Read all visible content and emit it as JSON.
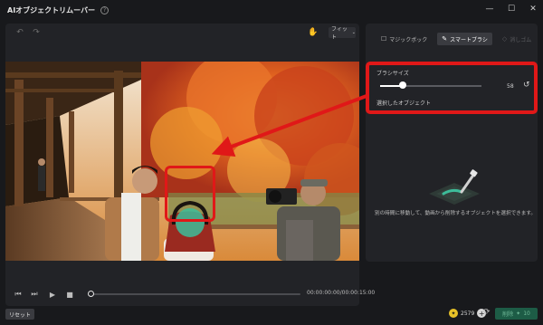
{
  "window": {
    "title": "AIオブジェクトリムーバー",
    "help_icon": "?",
    "controls": {
      "minimize": "—",
      "maximize": "☐",
      "close": "✕"
    }
  },
  "toolbar": {
    "undo_icon": "↶",
    "redo_icon": "↷",
    "hand_icon": "✋",
    "fit_label": "フィット",
    "fit_chevron": "⌄"
  },
  "playback": {
    "prev_icon": "⏮",
    "step_icon": "⏭",
    "play_icon": "▶",
    "stop_icon": "■",
    "time": "00:00:00:00/00:00:15:00",
    "progress": 0
  },
  "right_panel": {
    "tabs": [
      {
        "label": "マジックボック",
        "icon": "☐",
        "state": "inactive"
      },
      {
        "label": "スマートブラシ",
        "icon": "✎",
        "state": "active"
      },
      {
        "label": "消しゴム",
        "icon": "◇",
        "state": "disabled"
      }
    ],
    "brush_size_label": "ブラシサイズ",
    "brush_size_value": "58",
    "brush_size_fraction": 0.22,
    "reset_icon": "↺",
    "selected_object_label": "選択したオブジェクト",
    "hint": "別の時間に移動して、動画から削除するオブジェクトを選択できます。"
  },
  "bottom": {
    "reset_label": "リセット",
    "credit_icon": "✦",
    "credits": "2579",
    "credit_plus": "+",
    "refresh_icon": "⟳",
    "remove_label": "削除",
    "remove_icon": "✦",
    "remove_cost": "10"
  },
  "colors": {
    "highlight": "#e01818",
    "accent_green": "#1d5c46",
    "background": "#18191c",
    "panel": "#222327"
  }
}
